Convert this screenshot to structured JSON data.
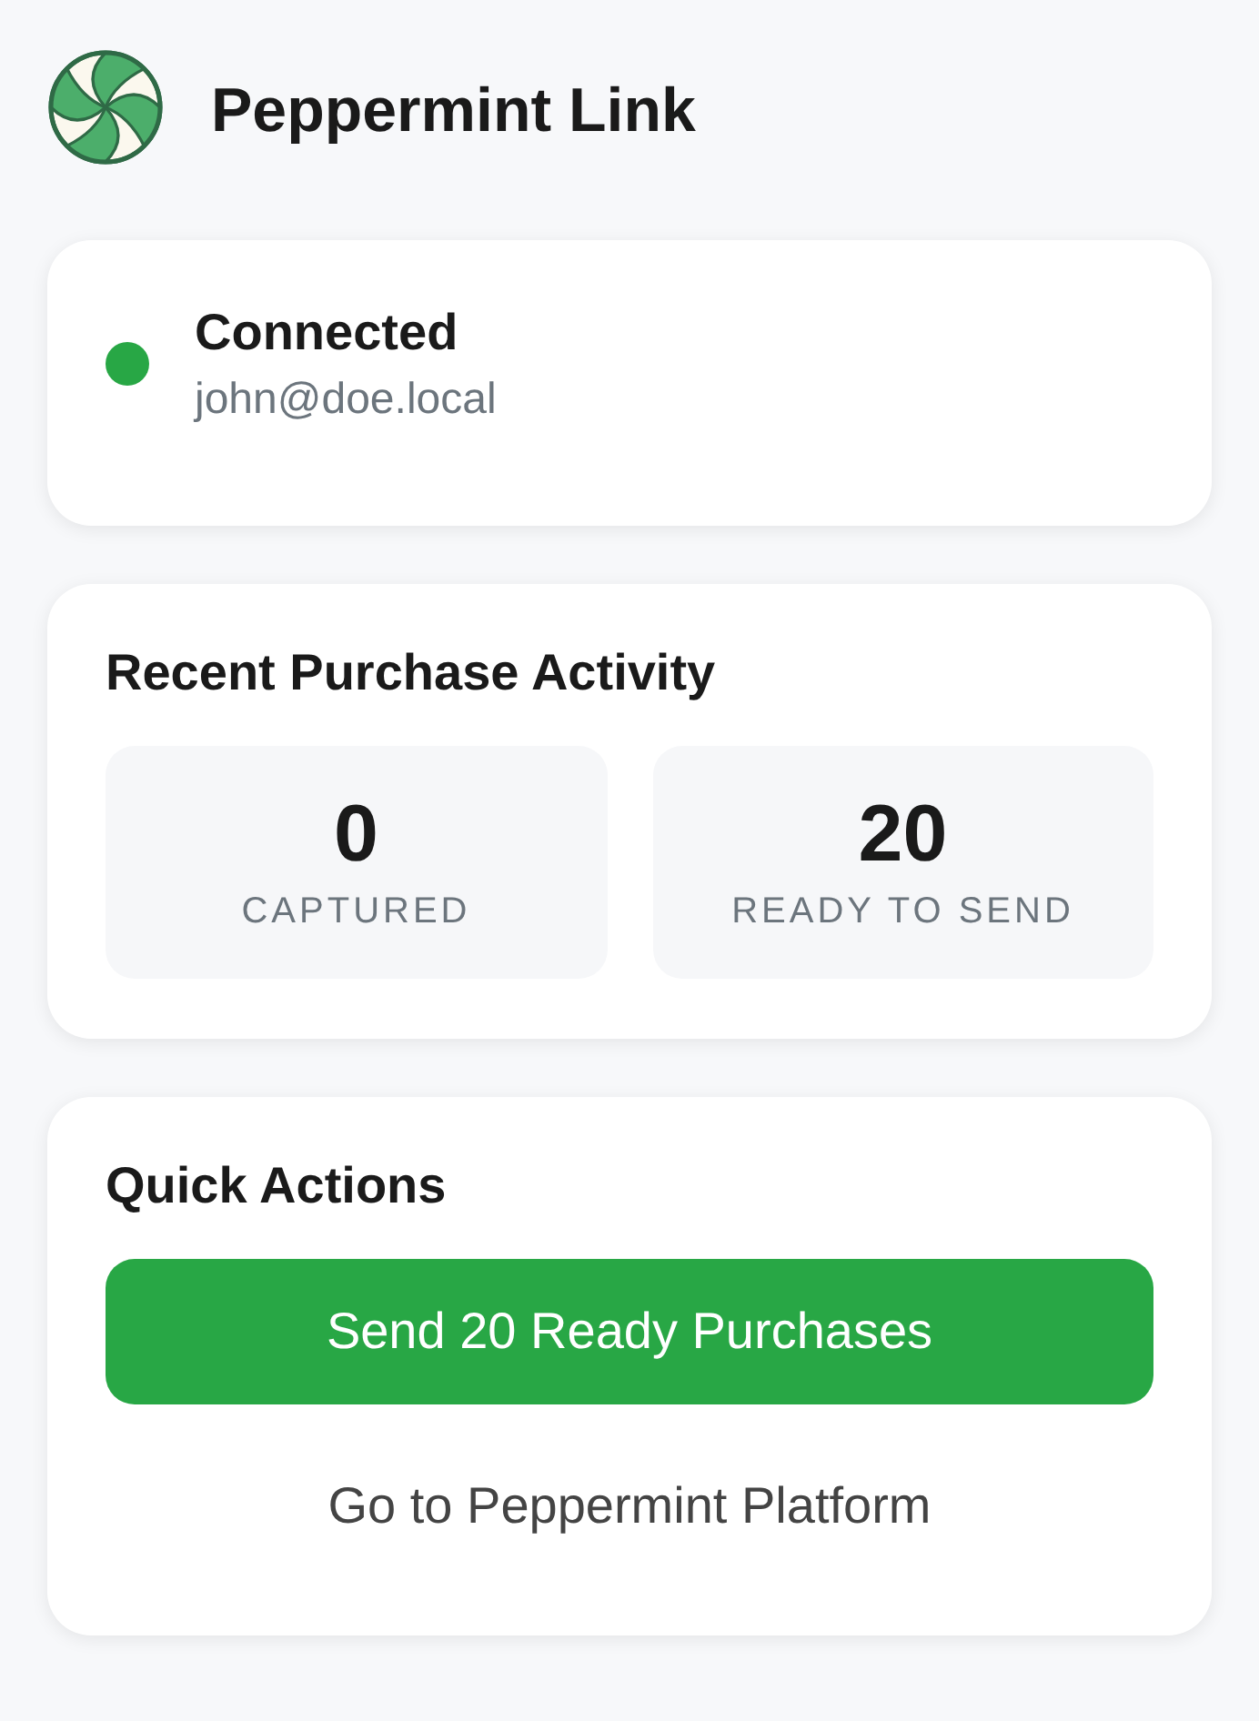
{
  "app": {
    "title": "Peppermint Link"
  },
  "connection": {
    "connected": true,
    "status": "Connected",
    "account": "john@doe.local"
  },
  "activity": {
    "title": "Recent Purchase Activity",
    "stats": [
      {
        "value": "0",
        "label": "CAPTURED"
      },
      {
        "value": "20",
        "label": "READY TO SEND"
      }
    ]
  },
  "quick_actions": {
    "title": "Quick Actions",
    "buttons": [
      {
        "kind": "primary",
        "label": "Send 20 Ready Purchases"
      },
      {
        "kind": "link",
        "label": "Go to Peppermint Platform"
      }
    ]
  }
}
